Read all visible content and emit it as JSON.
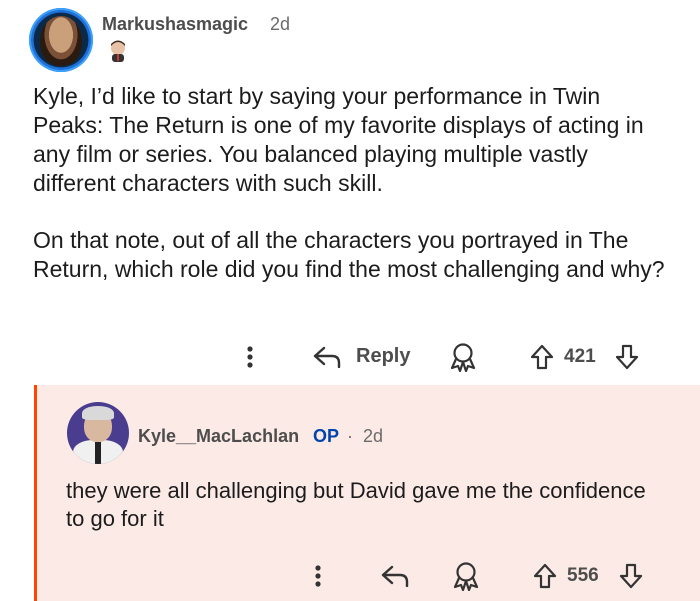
{
  "parent_comment": {
    "username": "Markushasmagic",
    "time": "2d",
    "paragraphs": [
      "Kyle, I’d like to start by saying your performance in Twin Peaks: The Return is one of my favorite displays of acting in any film or series. You balanced playing multiple vastly different characters with such skill.",
      "On that note, out of all the characters you portrayed in The Return, which role did you find the most challenging and why?"
    ],
    "actions": {
      "reply_label": "Reply",
      "vote_count": "421"
    }
  },
  "reply_comment": {
    "username": "Kyle__MacLachlan",
    "op_badge": "OP",
    "separator": "·",
    "time": "2d",
    "text": "they were all challenging but David gave me the confidence to go for it",
    "actions": {
      "vote_count": "556"
    }
  },
  "colors": {
    "accent_op": "#0045ac",
    "thread_line": "#ff4500",
    "reply_bg": "#fbeae5"
  },
  "icons": [
    "more-options-icon",
    "reply-icon",
    "award-icon",
    "upvote-icon",
    "downvote-icon"
  ]
}
